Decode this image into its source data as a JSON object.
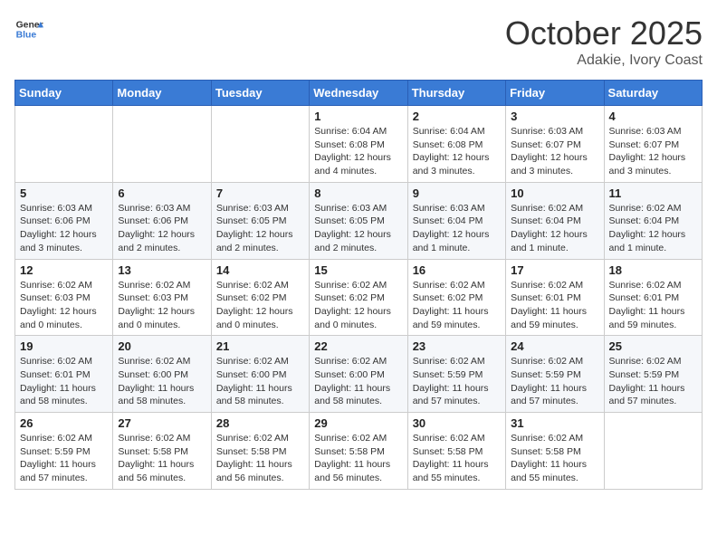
{
  "header": {
    "logo_general": "General",
    "logo_blue": "Blue",
    "month": "October 2025",
    "location": "Adakie, Ivory Coast"
  },
  "weekdays": [
    "Sunday",
    "Monday",
    "Tuesday",
    "Wednesday",
    "Thursday",
    "Friday",
    "Saturday"
  ],
  "weeks": [
    [
      {
        "day": "",
        "info": ""
      },
      {
        "day": "",
        "info": ""
      },
      {
        "day": "",
        "info": ""
      },
      {
        "day": "1",
        "info": "Sunrise: 6:04 AM\nSunset: 6:08 PM\nDaylight: 12 hours\nand 4 minutes."
      },
      {
        "day": "2",
        "info": "Sunrise: 6:04 AM\nSunset: 6:08 PM\nDaylight: 12 hours\nand 3 minutes."
      },
      {
        "day": "3",
        "info": "Sunrise: 6:03 AM\nSunset: 6:07 PM\nDaylight: 12 hours\nand 3 minutes."
      },
      {
        "day": "4",
        "info": "Sunrise: 6:03 AM\nSunset: 6:07 PM\nDaylight: 12 hours\nand 3 minutes."
      }
    ],
    [
      {
        "day": "5",
        "info": "Sunrise: 6:03 AM\nSunset: 6:06 PM\nDaylight: 12 hours\nand 3 minutes."
      },
      {
        "day": "6",
        "info": "Sunrise: 6:03 AM\nSunset: 6:06 PM\nDaylight: 12 hours\nand 2 minutes."
      },
      {
        "day": "7",
        "info": "Sunrise: 6:03 AM\nSunset: 6:05 PM\nDaylight: 12 hours\nand 2 minutes."
      },
      {
        "day": "8",
        "info": "Sunrise: 6:03 AM\nSunset: 6:05 PM\nDaylight: 12 hours\nand 2 minutes."
      },
      {
        "day": "9",
        "info": "Sunrise: 6:03 AM\nSunset: 6:04 PM\nDaylight: 12 hours\nand 1 minute."
      },
      {
        "day": "10",
        "info": "Sunrise: 6:02 AM\nSunset: 6:04 PM\nDaylight: 12 hours\nand 1 minute."
      },
      {
        "day": "11",
        "info": "Sunrise: 6:02 AM\nSunset: 6:04 PM\nDaylight: 12 hours\nand 1 minute."
      }
    ],
    [
      {
        "day": "12",
        "info": "Sunrise: 6:02 AM\nSunset: 6:03 PM\nDaylight: 12 hours\nand 0 minutes."
      },
      {
        "day": "13",
        "info": "Sunrise: 6:02 AM\nSunset: 6:03 PM\nDaylight: 12 hours\nand 0 minutes."
      },
      {
        "day": "14",
        "info": "Sunrise: 6:02 AM\nSunset: 6:02 PM\nDaylight: 12 hours\nand 0 minutes."
      },
      {
        "day": "15",
        "info": "Sunrise: 6:02 AM\nSunset: 6:02 PM\nDaylight: 12 hours\nand 0 minutes."
      },
      {
        "day": "16",
        "info": "Sunrise: 6:02 AM\nSunset: 6:02 PM\nDaylight: 11 hours\nand 59 minutes."
      },
      {
        "day": "17",
        "info": "Sunrise: 6:02 AM\nSunset: 6:01 PM\nDaylight: 11 hours\nand 59 minutes."
      },
      {
        "day": "18",
        "info": "Sunrise: 6:02 AM\nSunset: 6:01 PM\nDaylight: 11 hours\nand 59 minutes."
      }
    ],
    [
      {
        "day": "19",
        "info": "Sunrise: 6:02 AM\nSunset: 6:01 PM\nDaylight: 11 hours\nand 58 minutes."
      },
      {
        "day": "20",
        "info": "Sunrise: 6:02 AM\nSunset: 6:00 PM\nDaylight: 11 hours\nand 58 minutes."
      },
      {
        "day": "21",
        "info": "Sunrise: 6:02 AM\nSunset: 6:00 PM\nDaylight: 11 hours\nand 58 minutes."
      },
      {
        "day": "22",
        "info": "Sunrise: 6:02 AM\nSunset: 6:00 PM\nDaylight: 11 hours\nand 58 minutes."
      },
      {
        "day": "23",
        "info": "Sunrise: 6:02 AM\nSunset: 5:59 PM\nDaylight: 11 hours\nand 57 minutes."
      },
      {
        "day": "24",
        "info": "Sunrise: 6:02 AM\nSunset: 5:59 PM\nDaylight: 11 hours\nand 57 minutes."
      },
      {
        "day": "25",
        "info": "Sunrise: 6:02 AM\nSunset: 5:59 PM\nDaylight: 11 hours\nand 57 minutes."
      }
    ],
    [
      {
        "day": "26",
        "info": "Sunrise: 6:02 AM\nSunset: 5:59 PM\nDaylight: 11 hours\nand 57 minutes."
      },
      {
        "day": "27",
        "info": "Sunrise: 6:02 AM\nSunset: 5:58 PM\nDaylight: 11 hours\nand 56 minutes."
      },
      {
        "day": "28",
        "info": "Sunrise: 6:02 AM\nSunset: 5:58 PM\nDaylight: 11 hours\nand 56 minutes."
      },
      {
        "day": "29",
        "info": "Sunrise: 6:02 AM\nSunset: 5:58 PM\nDaylight: 11 hours\nand 56 minutes."
      },
      {
        "day": "30",
        "info": "Sunrise: 6:02 AM\nSunset: 5:58 PM\nDaylight: 11 hours\nand 55 minutes."
      },
      {
        "day": "31",
        "info": "Sunrise: 6:02 AM\nSunset: 5:58 PM\nDaylight: 11 hours\nand 55 minutes."
      },
      {
        "day": "",
        "info": ""
      }
    ]
  ]
}
